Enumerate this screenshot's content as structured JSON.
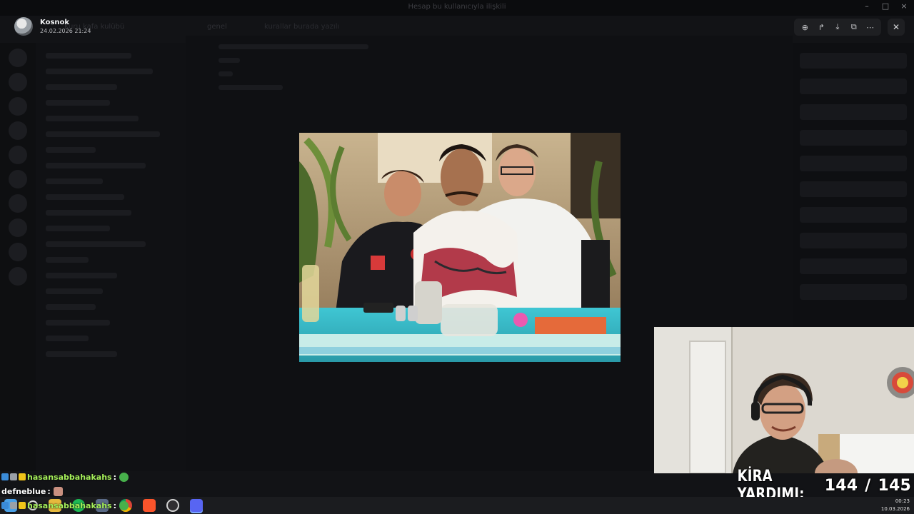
{
  "window": {
    "title": "Hesap bu kullanıcıyla ilişkili",
    "controls": [
      "–",
      "□",
      "×"
    ]
  },
  "background": {
    "server_name": "Kuru kafa kulübü",
    "channel_name": "genel",
    "channel_topic": "kurallar burada yazılı",
    "message_hint": "Kosnok"
  },
  "viewer": {
    "uploader_name": "Kosnok",
    "upload_date": "24.02.2026 21:24",
    "toolbar": [
      {
        "name": "zoom-icon",
        "glyph": "⊕"
      },
      {
        "name": "forward-icon",
        "glyph": "↱"
      },
      {
        "name": "download-icon",
        "glyph": "⤓"
      },
      {
        "name": "open-external-icon",
        "glyph": "⧉"
      },
      {
        "name": "more-icon",
        "glyph": "⋯"
      }
    ],
    "close_glyph": "✕"
  },
  "overlay": {
    "label": "KİRA YARDIMI:",
    "current": "144",
    "separator": "/",
    "goal": "145",
    "progress_fraction": 0.993
  },
  "chat": [
    {
      "user": "hasansabbahakahs",
      "sep": ":",
      "style": "green"
    },
    {
      "user": "defneblue",
      "sep": ":",
      "style": "white"
    },
    {
      "user": "hasansabbahakahs",
      "sep": ":",
      "style": "green"
    }
  ],
  "taskbar": {
    "apps": [
      "start-icon",
      "search-icon",
      "file-explorer-icon",
      "spotify-icon",
      "calculator-icon",
      "chrome-icon",
      "brave-icon",
      "obs-icon",
      "discord-icon"
    ],
    "active_app": "discord-icon"
  },
  "clock": {
    "time": "00:23",
    "date": "10.03.2026"
  },
  "colors": {
    "chat_green": "#a6f05a",
    "discord_blurple": "#5865f2",
    "viewer_toolbar_bg": "#1e1f22"
  }
}
